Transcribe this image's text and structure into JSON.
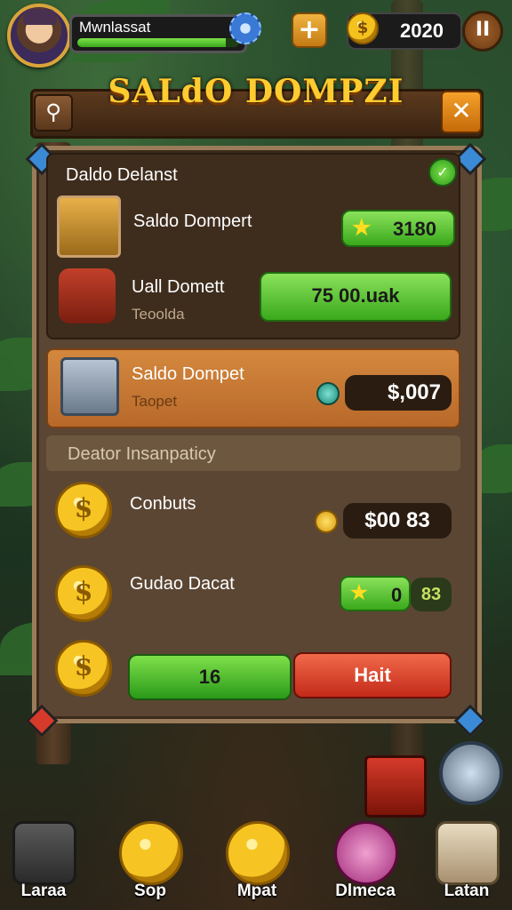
{
  "player": {
    "name": "Mwnlassat"
  },
  "currency": {
    "amount": "2020"
  },
  "header": {
    "title": "SALdO DOMPZI"
  },
  "panel": {
    "section_title": "Daldo Delanst",
    "rows": [
      {
        "label": "Saldo Dompert",
        "value": "3180"
      },
      {
        "label": "Uall Domett",
        "sub": "Teoolda",
        "value": "75 00.uak"
      },
      {
        "label": "Saldo Dompet",
        "sub": "Taopet",
        "value": "$,007"
      }
    ],
    "section2_title": "Deator Insanpaticy",
    "rows2": [
      {
        "label": "Conbuts",
        "value": "$00 83"
      },
      {
        "label": "Gudao Dacat",
        "value": "0",
        "extra": "83"
      }
    ],
    "buttons": {
      "confirm": "16",
      "cancel": "Hait"
    }
  },
  "nav": [
    {
      "label": "Laraa"
    },
    {
      "label": "Sop"
    },
    {
      "label": "Mpat"
    },
    {
      "label": "Dlmeca"
    },
    {
      "label": "Latan"
    }
  ],
  "icons": {
    "search": "search-icon",
    "close": "close-icon",
    "add": "plus-icon",
    "pause": "pause-icon",
    "settings": "gear-icon",
    "coin": "coin-icon",
    "check": "check-icon",
    "star": "star-icon"
  },
  "colors": {
    "accent": "#ffcc30",
    "green": "#3aa81c",
    "red": "#d63a2a",
    "orange": "#d4883e"
  }
}
